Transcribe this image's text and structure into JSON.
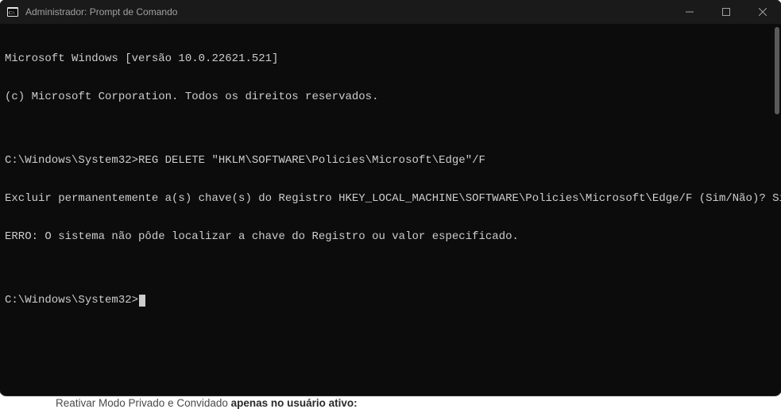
{
  "titlebar": {
    "title": "Administrador: Prompt de Comando"
  },
  "terminal": {
    "line1": "Microsoft Windows [versão 10.0.22621.521]",
    "line2": "(c) Microsoft Corporation. Todos os direitos reservados.",
    "blank1": "",
    "line3": "C:\\Windows\\System32>REG DELETE \"HKLM\\SOFTWARE\\Policies\\Microsoft\\Edge\"/F",
    "line4": "Excluir permanentemente a(s) chave(s) do Registro HKEY_LOCAL_MACHINE\\SOFTWARE\\Policies\\Microsoft\\Edge/F (Sim/Não)? Sim",
    "line5": "ERRO: O sistema não pôde localizar a chave do Registro ou valor especificado.",
    "blank2": "",
    "prompt": "C:\\Windows\\System32>"
  },
  "below": {
    "faint": "Reativar Modo Privado e Convidado ",
    "bold": "apenas no usuário ativo:"
  }
}
